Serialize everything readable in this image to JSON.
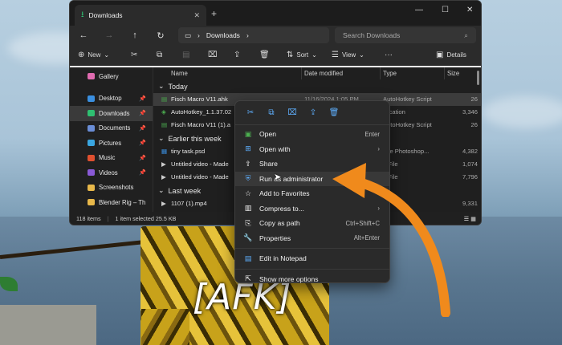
{
  "scene": {
    "overlay_text": "[AFK]"
  },
  "explorer": {
    "tab_title": "Downloads",
    "address": "Downloads",
    "search_placeholder": "Search Downloads",
    "toolbar": {
      "new": "New",
      "sort": "Sort",
      "view": "View",
      "details": "Details",
      "more": "···"
    },
    "nav": [
      {
        "label": "Gallery",
        "icon": "gallery-icon",
        "color": "#e06bb0"
      },
      {
        "label": "Desktop",
        "icon": "desktop-icon",
        "color": "#3a8fe0"
      },
      {
        "label": "Downloads",
        "icon": "download-icon",
        "color": "#2fbf71"
      },
      {
        "label": "Documents",
        "icon": "documents-icon",
        "color": "#6a8dd6"
      },
      {
        "label": "Pictures",
        "icon": "pictures-icon",
        "color": "#3aa6e0"
      },
      {
        "label": "Music",
        "icon": "music-icon",
        "color": "#e0502f"
      },
      {
        "label": "Videos",
        "icon": "videos-icon",
        "color": "#8a5ad6"
      },
      {
        "label": "Screenshots",
        "icon": "folder-icon",
        "color": "#e8b84a"
      },
      {
        "label": "Blender Rig – Th",
        "icon": "folder-icon",
        "color": "#e8b84a"
      }
    ],
    "columns": {
      "name": "Name",
      "date": "Date modified",
      "type": "Type",
      "size": "Size"
    },
    "groups": {
      "today": "Today",
      "earlier": "Earlier this week",
      "last": "Last week"
    },
    "files_today": [
      {
        "name": "Fisch Macro V11.ahk",
        "date": "11/16/2024 1:05 PM",
        "type": "AutoHotkey Script",
        "size": "26"
      },
      {
        "name": "AutoHotkey_1.1.37.02",
        "date": "",
        "type": "plication",
        "size": "3,346"
      },
      {
        "name": "Fisch Macro V11 (1).a",
        "date": "",
        "type": "AutoHotkey Script",
        "size": "26"
      }
    ],
    "files_earlier": [
      {
        "name": "tiny task.psd",
        "date": "",
        "type": "obe Photoshop...",
        "size": "4,382"
      },
      {
        "name": "Untitled video - Made",
        "date": "",
        "type": "4 File",
        "size": "1,074"
      },
      {
        "name": "Untitled video - Made",
        "date": "",
        "type": "4 File",
        "size": "7,796"
      }
    ],
    "files_last": [
      {
        "name": "1107 (1).mp4",
        "date": "",
        "type": "",
        "size": "9,331"
      }
    ],
    "status": {
      "count": "118 items",
      "selected": "1 item selected 25.5 KB"
    }
  },
  "context_menu": {
    "items": [
      {
        "label": "Open",
        "shortcut": "Enter",
        "icon": "app-icon"
      },
      {
        "label": "Open with",
        "shortcut": "",
        "icon": "open-with-icon",
        "submenu": true
      },
      {
        "label": "Share",
        "shortcut": "",
        "icon": "share-icon"
      },
      {
        "label": "Run as administrator",
        "shortcut": "",
        "icon": "shield-icon"
      },
      {
        "label": "Add to Favorites",
        "shortcut": "",
        "icon": "star-icon"
      },
      {
        "label": "Compress to...",
        "shortcut": "",
        "icon": "zip-icon",
        "submenu": true
      },
      {
        "label": "Copy as path",
        "shortcut": "Ctrl+Shift+C",
        "icon": "path-icon"
      },
      {
        "label": "Properties",
        "shortcut": "Alt+Enter",
        "icon": "wrench-icon"
      },
      {
        "label": "Edit in Notepad",
        "shortcut": "",
        "icon": "notepad-icon"
      },
      {
        "label": "Show more options",
        "shortcut": "",
        "icon": "more-options-icon"
      }
    ]
  },
  "colors": {
    "accent": "#5fb0ff",
    "arrow": "#f08a1c"
  }
}
